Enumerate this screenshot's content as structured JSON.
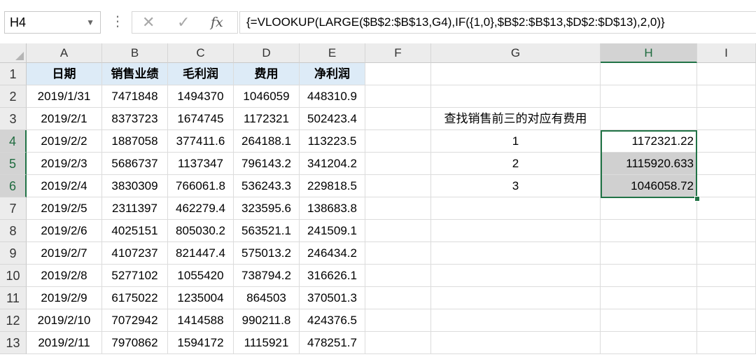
{
  "formula_bar": {
    "name_box": "H4",
    "cancel_glyph": "✕",
    "enter_glyph": "✓",
    "fx_label": "fx",
    "formula": "{=VLOOKUP(LARGE($B$2:$B$13,G4),IF({1,0},$B$2:$B$13,$D$2:$D$13),2,0)}"
  },
  "columns": [
    "A",
    "B",
    "C",
    "D",
    "E",
    "F",
    "G",
    "H",
    "I"
  ],
  "rows": [
    "1",
    "2",
    "3",
    "4",
    "5",
    "6",
    "7",
    "8",
    "9",
    "10",
    "11",
    "12",
    "13"
  ],
  "selected_column": "H",
  "selected_rows": [
    "4",
    "5",
    "6"
  ],
  "table": {
    "headers": [
      "日期",
      "销售业绩",
      "毛利润",
      "费用",
      "净利润"
    ],
    "data": [
      [
        "2019/1/31",
        "7471848",
        "1494370",
        "1046059",
        "448310.9"
      ],
      [
        "2019/2/1",
        "8373723",
        "1674745",
        "1172321",
        "502423.4"
      ],
      [
        "2019/2/2",
        "1887058",
        "377411.6",
        "264188.1",
        "113223.5"
      ],
      [
        "2019/2/3",
        "5686737",
        "1137347",
        "796143.2",
        "341204.2"
      ],
      [
        "2019/2/4",
        "3830309",
        "766061.8",
        "536243.3",
        "229818.5"
      ],
      [
        "2019/2/5",
        "2311397",
        "462279.4",
        "323595.6",
        "138683.8"
      ],
      [
        "2019/2/6",
        "4025151",
        "805030.2",
        "563521.1",
        "241509.1"
      ],
      [
        "2019/2/7",
        "4107237",
        "821447.4",
        "575013.2",
        "246434.2"
      ],
      [
        "2019/2/8",
        "5277102",
        "1055420",
        "738794.2",
        "316626.1"
      ],
      [
        "2019/2/9",
        "6175022",
        "1235004",
        "864503",
        "370501.3"
      ],
      [
        "2019/2/10",
        "7072942",
        "1414588",
        "990211.8",
        "424376.5"
      ],
      [
        "2019/2/11",
        "7970862",
        "1594172",
        "1115921",
        "478251.7"
      ]
    ]
  },
  "lookup": {
    "title": "查找销售前三的对应有费用",
    "ranks": [
      "1",
      "2",
      "3"
    ],
    "results": [
      "1172321.22",
      "1115920.633",
      "1046058.72"
    ]
  },
  "colors": {
    "accent": "#217346",
    "header_fill": "#ddebf7",
    "selection_fill": "#d0d0d0"
  }
}
